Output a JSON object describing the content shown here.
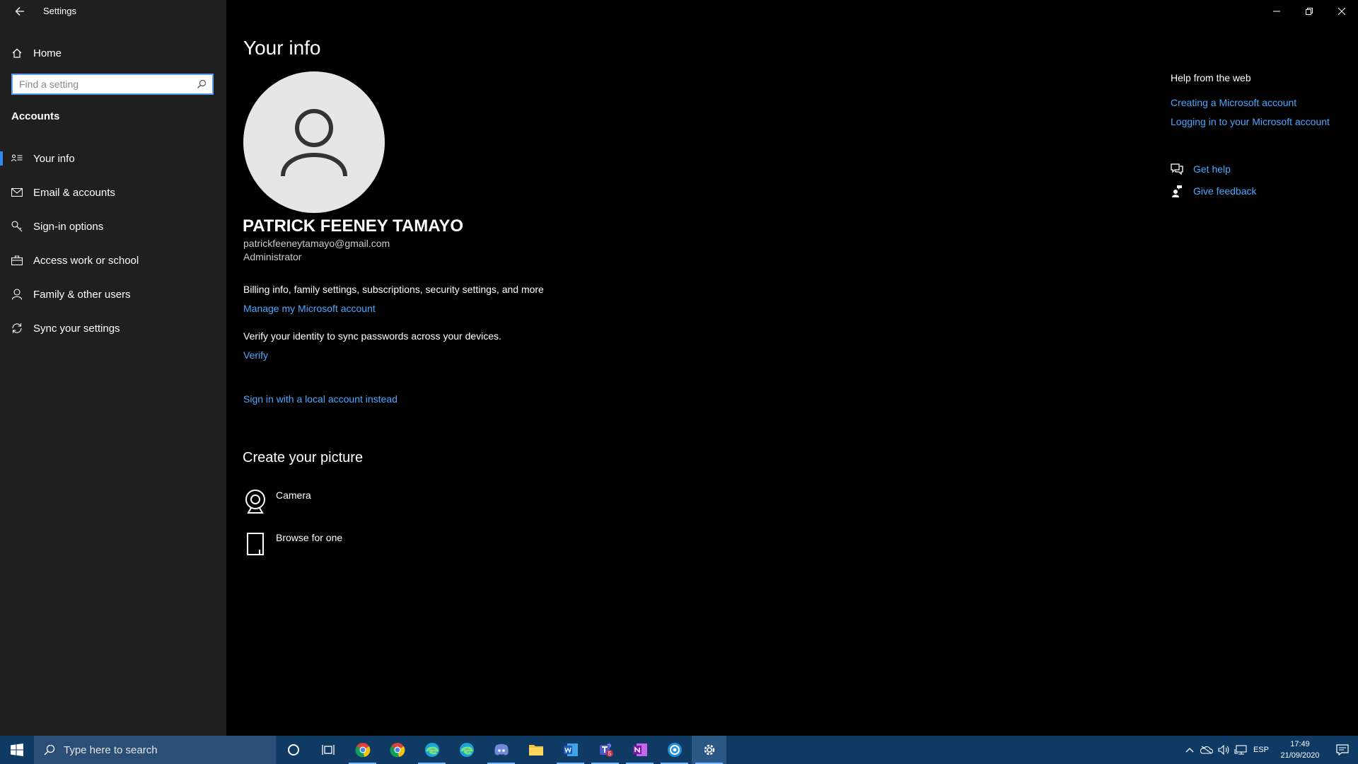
{
  "window": {
    "title": "Settings",
    "controls": {
      "minimize": "minimize-icon",
      "restore": "restore-icon",
      "close": "close-icon"
    }
  },
  "sidebar": {
    "home_label": "Home",
    "search_placeholder": "Find a setting",
    "section_title": "Accounts",
    "items": [
      {
        "label": "Your info",
        "icon": "your-info-icon",
        "active": true
      },
      {
        "label": "Email & accounts",
        "icon": "mail-icon"
      },
      {
        "label": "Sign-in options",
        "icon": "key-icon"
      },
      {
        "label": "Access work or school",
        "icon": "briefcase-icon"
      },
      {
        "label": "Family & other users",
        "icon": "person-icon"
      },
      {
        "label": "Sync your settings",
        "icon": "sync-icon"
      }
    ]
  },
  "main": {
    "title": "Your info",
    "user": {
      "name": "PATRICK FEENEY TAMAYO",
      "email": "patrickfeeneytamayo@gmail.com",
      "role": "Administrator"
    },
    "billing_text": "Billing info, family settings, subscriptions, security settings, and more",
    "manage_link": "Manage my Microsoft account",
    "verify_text": "Verify your identity to sync passwords across your devices.",
    "verify_link": "Verify",
    "local_account_link": "Sign in with a local account instead",
    "create_picture": {
      "title": "Create your picture",
      "camera_label": "Camera",
      "browse_label": "Browse for one"
    }
  },
  "help": {
    "title": "Help from the web",
    "links": [
      "Creating a Microsoft account",
      "Logging in to your Microsoft account"
    ],
    "get_help": "Get help",
    "give_feedback": "Give feedback"
  },
  "taskbar": {
    "search_placeholder": "Type here to search",
    "apps": [
      "chrome-icon",
      "chrome-icon",
      "edge-icon",
      "edge-icon",
      "discord-icon",
      "file-explorer-icon",
      "word-icon",
      "teams-icon",
      "onenote-icon",
      "uplay-icon",
      "settings-icon"
    ],
    "teams_badge": "5",
    "language": "ESP",
    "time": "17:49",
    "date": "21/09/2020"
  },
  "colors": {
    "accent": "#4ca7ff",
    "sidebar_bg": "#1f1f1f",
    "taskbar_bg": "#0f3a64"
  }
}
